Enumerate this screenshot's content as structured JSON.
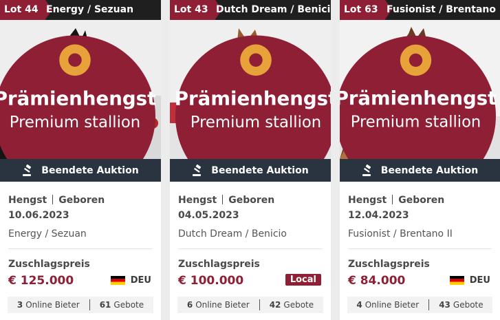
{
  "cards": [
    {
      "lot": "Lot 44",
      "name": "Energy / Sezuan",
      "badge": {
        "line1": "Prämienhengst",
        "line2": "Premium stallion"
      },
      "status": "Beendete Auktion",
      "meta_sex": "Hengst",
      "meta_born_label": "Geboren",
      "birth_date": "10.06.2023",
      "pedigree": "Energy / Sezuan",
      "price_label": "Zuschlagspreis",
      "price": "€ 125.000",
      "country": "DEU",
      "online_bidders": "3",
      "online_bidders_label": "Online Bieter",
      "bids": "61",
      "bids_label": "Gebote"
    },
    {
      "lot": "Lot 43",
      "name": "Dutch Dream / Benicio",
      "badge": {
        "line1": "Prämienhengst",
        "line2": "Premium stallion"
      },
      "status": "Beendete Auktion",
      "meta_sex": "Hengst",
      "meta_born_label": "Geboren",
      "birth_date": "04.05.2023",
      "pedigree": "Dutch Dream / Benicio",
      "price_label": "Zuschlagspreis",
      "price": "€ 100.000",
      "local_tag": "Local",
      "online_bidders": "6",
      "online_bidders_label": "Online Bieter",
      "bids": "42",
      "bids_label": "Gebote"
    },
    {
      "lot": "Lot 63",
      "name": "Fusionist / Brentano II",
      "badge": {
        "line1": "Prämienhengst",
        "line2": "Premium stallion"
      },
      "status": "Beendete Auktion",
      "meta_sex": "Hengst",
      "meta_born_label": "Geboren",
      "birth_date": "12.04.2023",
      "pedigree": "Fusionist / Brentano II",
      "price_label": "Zuschlagspreis",
      "price": "€ 84.000",
      "country": "DEU",
      "online_bidders": "4",
      "online_bidders_label": "Online Bieter",
      "bids": "43",
      "bids_label": "Gebote"
    }
  ],
  "colors": {
    "accent": "#8e1f35",
    "status_bar": "#2a3340",
    "header": "#1f1f1f"
  }
}
